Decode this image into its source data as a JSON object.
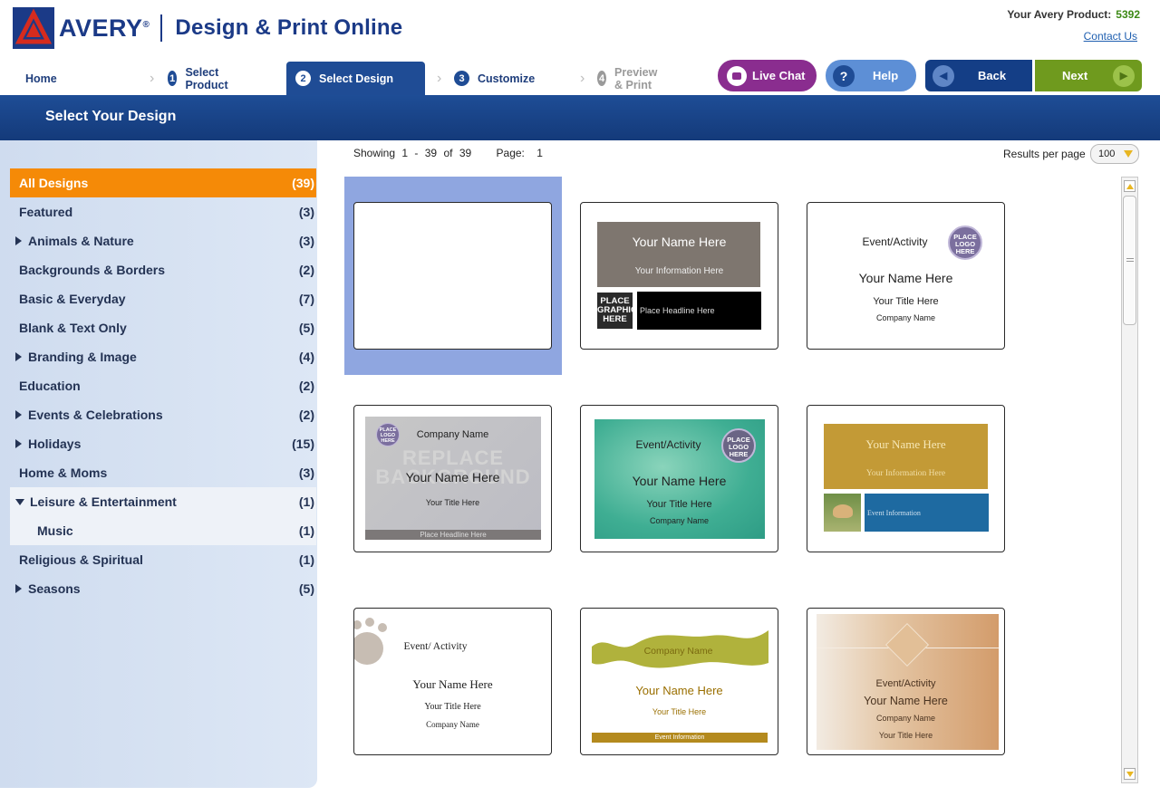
{
  "header": {
    "brand": "AVERY",
    "brand_reg": "®",
    "product_line": "Design & Print Online",
    "your_product_label": "Your Avery Product:",
    "your_product_number": "5392",
    "contact_link": "Contact Us"
  },
  "steps": [
    {
      "label": "Home"
    },
    {
      "num": "1",
      "label": "Select Product"
    },
    {
      "num": "2",
      "label": "Select Design"
    },
    {
      "num": "3",
      "label": "Customize"
    },
    {
      "num": "4",
      "label": "Preview & Print"
    }
  ],
  "buttons": {
    "live_chat": "Live Chat",
    "help": "Help",
    "help_icon": "?",
    "back": "Back",
    "next": "Next"
  },
  "page_title": "Select Your Design",
  "categories": [
    {
      "label": "All Designs",
      "count": "(39)"
    },
    {
      "label": "Featured",
      "count": "(3)"
    },
    {
      "label": "Animals & Nature",
      "count": "(3)"
    },
    {
      "label": "Backgrounds & Borders",
      "count": "(2)"
    },
    {
      "label": "Basic & Everyday",
      "count": "(7)"
    },
    {
      "label": "Blank & Text Only",
      "count": "(5)"
    },
    {
      "label": "Branding & Image",
      "count": "(4)"
    },
    {
      "label": "Education",
      "count": "(2)"
    },
    {
      "label": "Events & Celebrations",
      "count": "(2)"
    },
    {
      "label": "Holidays",
      "count": "(15)"
    },
    {
      "label": "Home & Moms",
      "count": "(3)"
    },
    {
      "label": "Leisure & Entertainment",
      "count": "(1)"
    },
    {
      "label": "Music",
      "count": "(1)"
    },
    {
      "label": "Religious & Spiritual",
      "count": "(1)"
    },
    {
      "label": "Seasons",
      "count": "(5)"
    }
  ],
  "results": {
    "showing_label": "Showing",
    "range_start": "1",
    "range_dash": "-",
    "range_end": "39",
    "of_label": "of",
    "total": "39",
    "page_label": "Page:",
    "page_number": "1",
    "per_page_label": "Results per page",
    "per_page_value": "100"
  },
  "cards": {
    "c2": {
      "name": "Your Name Here",
      "info": "Your Information Here",
      "graphic": "PLACE GRAPHIC HERE",
      "headline": "Place Headline Here"
    },
    "c3": {
      "event": "Event/Activity",
      "logo": "PLACE LOGO HERE",
      "name": "Your Name Here",
      "title": "Your Title Here",
      "company": "Company Name"
    },
    "c4": {
      "logo": "PLACE LOGO HERE",
      "company": "Company Name",
      "bg_text": "REPLACE BACKGROUND",
      "name": "Your Name Here",
      "title": "Your Title Here",
      "headline": "Place Headline Here"
    },
    "c5": {
      "event": "Event/Activity",
      "logo": "PLACE LOGO HERE",
      "name": "Your Name Here",
      "title": "Your Title Here",
      "company": "Company Name"
    },
    "c6": {
      "name": "Your Name Here",
      "info": "Your Information Here",
      "event": "Event Information"
    },
    "c7": {
      "event": "Event/ Activity",
      "name": "Your Name Here",
      "title": "Your Title Here",
      "company": "Company Name"
    },
    "c8": {
      "company": "Company Name",
      "name": "Your Name Here",
      "title": "Your Title Here",
      "event": "Event Information"
    },
    "c9": {
      "event": "Event/Activity",
      "name": "Your Name Here",
      "company": "Company Name",
      "title": "Your Title Here"
    }
  }
}
